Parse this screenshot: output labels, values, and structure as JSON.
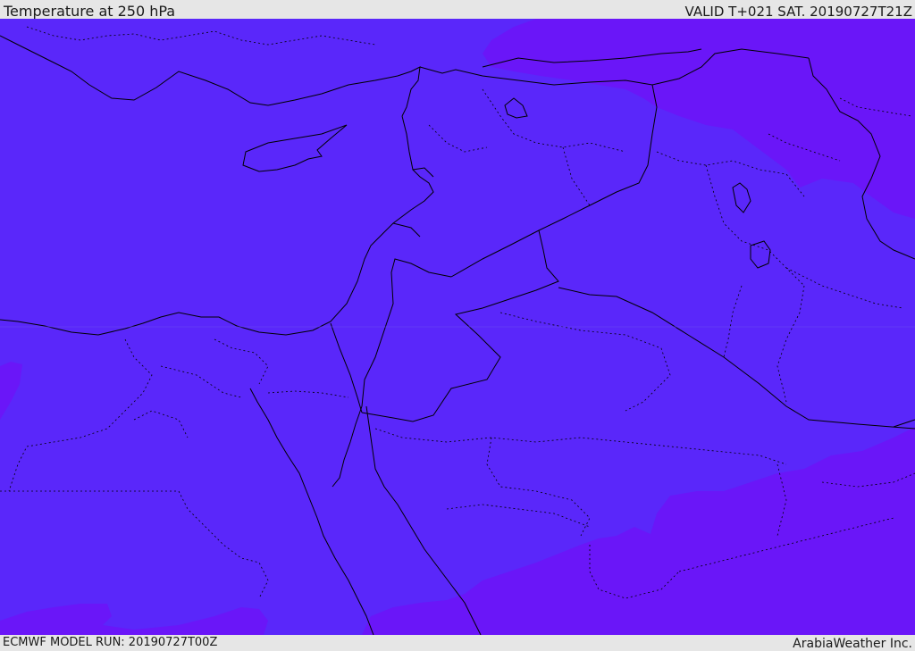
{
  "header": {
    "title": "Temperature at 250 hPa",
    "valid": "VALID T+021 SAT. 20190727T21Z"
  },
  "footer": {
    "model_run": "ECMWF MODEL RUN: 20190727T00Z",
    "brand": "ArabiaWeather Inc."
  },
  "map": {
    "variable": "Temperature",
    "level": "250 hPa",
    "colors": {
      "fill_base": "#5a27fa",
      "fill_cold": "#6a16f8",
      "borders": "#000000",
      "coast": "#000000"
    }
  }
}
